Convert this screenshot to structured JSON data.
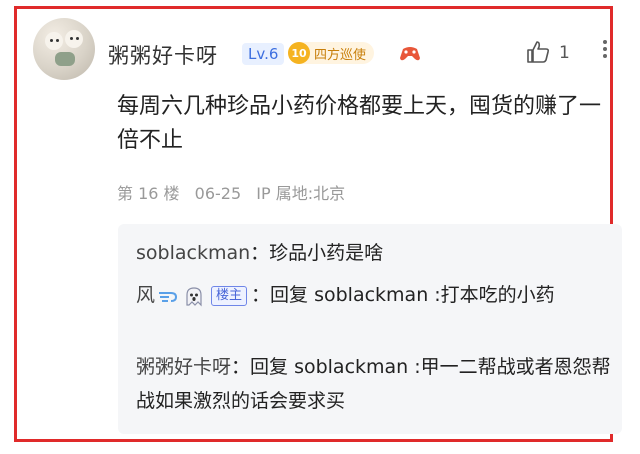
{
  "comment": {
    "username": "粥粥好卡呀",
    "level": "Lv.6",
    "medal_icon_text": "10",
    "medal_label": "四方巡使",
    "like_count": "1",
    "text": "每周六几种珍品小药价格都要上天，囤货的赚了一倍不止",
    "floor": "第 16 楼",
    "date": "06-25",
    "ip_location": "IP 属地:北京"
  },
  "replies": [
    {
      "name": "soblackman",
      "colon": "：",
      "text": "珍品小药是啥"
    },
    {
      "name": "风",
      "op_tag": "楼主",
      "colon": "：",
      "text": "回复 soblackman :打本吃的小药"
    },
    {
      "name": "粥粥好卡呀",
      "colon": "：",
      "text": "回复 soblackman :甲一二帮战或者恩怨帮战如果激烈的话会要求买"
    }
  ],
  "colors": {
    "frame_border": "#e02a2a",
    "level_badge_bg": "#e8f0ff",
    "level_badge_text": "#3d6fe0",
    "medal_coin": "#f5b320",
    "op_tag": "#4b67d8"
  }
}
